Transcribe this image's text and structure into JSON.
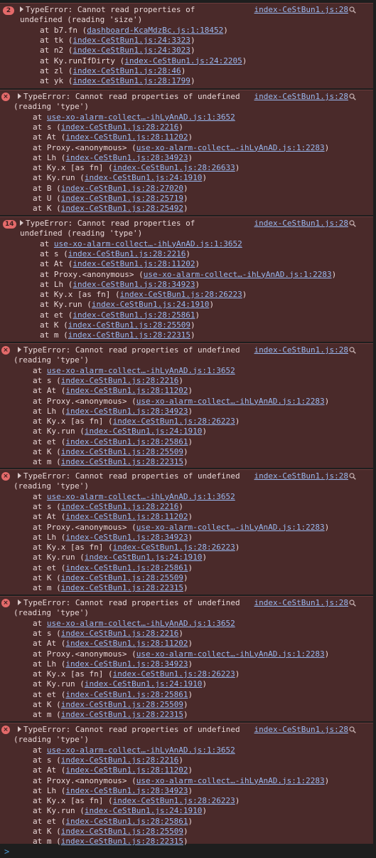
{
  "entries": [
    {
      "badge": "2",
      "badge_kind": "count",
      "message_lines": [
        "TypeError: Cannot read properties of",
        "undefined (reading 'size')"
      ],
      "source": "index-CeStBun1.js:28",
      "frames": [
        {
          "fn": "b7.fn",
          "file": "dashboard-KcaMdzBc.js:1:18452"
        },
        {
          "fn": "tk",
          "file": "index-CeStBun1.js:24:3323"
        },
        {
          "fn": "n2",
          "file": "index-CeStBun1.js:24:3023"
        },
        {
          "fn": "Ky.runIfDirty",
          "file": "index-CeStBun1.js:24:2205"
        },
        {
          "fn": "zl",
          "file": "index-CeStBun1.js:28:46"
        },
        {
          "fn": "yk",
          "file": "index-CeStBun1.js:28:1799"
        }
      ]
    },
    {
      "badge": "×",
      "badge_kind": "error",
      "message_lines": [
        "TypeError: Cannot read properties of undefined",
        "(reading 'type')"
      ],
      "source": "index-CeStBun1.js:28",
      "frames": [
        {
          "fn": "",
          "file": "use-xo-alarm-collect…-ihLyAnAD.js:1:3652"
        },
        {
          "fn": "s",
          "file": "index-CeStBun1.js:28:2216"
        },
        {
          "fn": "At",
          "file": "index-CeStBun1.js:28:11202"
        },
        {
          "fn": "Proxy.<anonymous>",
          "file": "use-xo-alarm-collect…-ihLyAnAD.js:1:2283"
        },
        {
          "fn": "Lh",
          "file": "index-CeStBun1.js:28:34923"
        },
        {
          "fn": "Ky.x [as fn]",
          "file": "index-CeStBun1.js:28:26633"
        },
        {
          "fn": "Ky.run",
          "file": "index-CeStBun1.js:24:1910"
        },
        {
          "fn": "B",
          "file": "index-CeStBun1.js:28:27020"
        },
        {
          "fn": "U",
          "file": "index-CeStBun1.js:28:25719"
        },
        {
          "fn": "K",
          "file": "index-CeStBun1.js:28:25492"
        }
      ]
    },
    {
      "badge": "14",
      "badge_kind": "count",
      "message_lines": [
        "TypeError: Cannot read properties of",
        "undefined (reading 'type')"
      ],
      "source": "index-CeStBun1.js:28",
      "frames": [
        {
          "fn": "",
          "file": "use-xo-alarm-collect…-ihLyAnAD.js:1:3652"
        },
        {
          "fn": "s",
          "file": "index-CeStBun1.js:28:2216"
        },
        {
          "fn": "At",
          "file": "index-CeStBun1.js:28:11202"
        },
        {
          "fn": "Proxy.<anonymous>",
          "file": "use-xo-alarm-collect…-ihLyAnAD.js:1:2283"
        },
        {
          "fn": "Lh",
          "file": "index-CeStBun1.js:28:34923"
        },
        {
          "fn": "Ky.x [as fn]",
          "file": "index-CeStBun1.js:28:26223"
        },
        {
          "fn": "Ky.run",
          "file": "index-CeStBun1.js:24:1910"
        },
        {
          "fn": "et",
          "file": "index-CeStBun1.js:28:25861"
        },
        {
          "fn": "K",
          "file": "index-CeStBun1.js:28:25509"
        },
        {
          "fn": "m",
          "file": "index-CeStBun1.js:28:22315"
        }
      ]
    },
    {
      "badge": "×",
      "badge_kind": "error",
      "message_lines": [
        "TypeError: Cannot read properties of undefined",
        "(reading 'type')"
      ],
      "source": "index-CeStBun1.js:28",
      "frames": [
        {
          "fn": "",
          "file": "use-xo-alarm-collect…-ihLyAnAD.js:1:3652"
        },
        {
          "fn": "s",
          "file": "index-CeStBun1.js:28:2216"
        },
        {
          "fn": "At",
          "file": "index-CeStBun1.js:28:11202"
        },
        {
          "fn": "Proxy.<anonymous>",
          "file": "use-xo-alarm-collect…-ihLyAnAD.js:1:2283"
        },
        {
          "fn": "Lh",
          "file": "index-CeStBun1.js:28:34923"
        },
        {
          "fn": "Ky.x [as fn]",
          "file": "index-CeStBun1.js:28:26223"
        },
        {
          "fn": "Ky.run",
          "file": "index-CeStBun1.js:24:1910"
        },
        {
          "fn": "et",
          "file": "index-CeStBun1.js:28:25861"
        },
        {
          "fn": "K",
          "file": "index-CeStBun1.js:28:25509"
        },
        {
          "fn": "m",
          "file": "index-CeStBun1.js:28:22315"
        }
      ]
    },
    {
      "badge": "×",
      "badge_kind": "error",
      "message_lines": [
        "TypeError: Cannot read properties of undefined",
        "(reading 'type')"
      ],
      "source": "index-CeStBun1.js:28",
      "frames": [
        {
          "fn": "",
          "file": "use-xo-alarm-collect…-ihLyAnAD.js:1:3652"
        },
        {
          "fn": "s",
          "file": "index-CeStBun1.js:28:2216"
        },
        {
          "fn": "At",
          "file": "index-CeStBun1.js:28:11202"
        },
        {
          "fn": "Proxy.<anonymous>",
          "file": "use-xo-alarm-collect…-ihLyAnAD.js:1:2283"
        },
        {
          "fn": "Lh",
          "file": "index-CeStBun1.js:28:34923"
        },
        {
          "fn": "Ky.x [as fn]",
          "file": "index-CeStBun1.js:28:26223"
        },
        {
          "fn": "Ky.run",
          "file": "index-CeStBun1.js:24:1910"
        },
        {
          "fn": "et",
          "file": "index-CeStBun1.js:28:25861"
        },
        {
          "fn": "K",
          "file": "index-CeStBun1.js:28:25509"
        },
        {
          "fn": "m",
          "file": "index-CeStBun1.js:28:22315"
        }
      ]
    },
    {
      "badge": "×",
      "badge_kind": "error",
      "message_lines": [
        "TypeError: Cannot read properties of undefined",
        "(reading 'type')"
      ],
      "source": "index-CeStBun1.js:28",
      "frames": [
        {
          "fn": "",
          "file": "use-xo-alarm-collect…-ihLyAnAD.js:1:3652"
        },
        {
          "fn": "s",
          "file": "index-CeStBun1.js:28:2216"
        },
        {
          "fn": "At",
          "file": "index-CeStBun1.js:28:11202"
        },
        {
          "fn": "Proxy.<anonymous>",
          "file": "use-xo-alarm-collect…-ihLyAnAD.js:1:2283"
        },
        {
          "fn": "Lh",
          "file": "index-CeStBun1.js:28:34923"
        },
        {
          "fn": "Ky.x [as fn]",
          "file": "index-CeStBun1.js:28:26223"
        },
        {
          "fn": "Ky.run",
          "file": "index-CeStBun1.js:24:1910"
        },
        {
          "fn": "et",
          "file": "index-CeStBun1.js:28:25861"
        },
        {
          "fn": "K",
          "file": "index-CeStBun1.js:28:25509"
        },
        {
          "fn": "m",
          "file": "index-CeStBun1.js:28:22315"
        }
      ]
    },
    {
      "badge": "×",
      "badge_kind": "error",
      "message_lines": [
        "TypeError: Cannot read properties of undefined",
        "(reading 'type')"
      ],
      "source": "index-CeStBun1.js:28",
      "frames": [
        {
          "fn": "",
          "file": "use-xo-alarm-collect…-ihLyAnAD.js:1:3652"
        },
        {
          "fn": "s",
          "file": "index-CeStBun1.js:28:2216"
        },
        {
          "fn": "At",
          "file": "index-CeStBun1.js:28:11202"
        },
        {
          "fn": "Proxy.<anonymous>",
          "file": "use-xo-alarm-collect…-ihLyAnAD.js:1:2283"
        },
        {
          "fn": "Lh",
          "file": "index-CeStBun1.js:28:34923"
        },
        {
          "fn": "Ky.x [as fn]",
          "file": "index-CeStBun1.js:28:26223"
        },
        {
          "fn": "Ky.run",
          "file": "index-CeStBun1.js:24:1910"
        },
        {
          "fn": "et",
          "file": "index-CeStBun1.js:28:25861"
        },
        {
          "fn": "K",
          "file": "index-CeStBun1.js:28:25509"
        },
        {
          "fn": "m",
          "file": "index-CeStBun1.js:28:22315"
        }
      ]
    }
  ],
  "prompt": ">",
  "colors": {
    "entry_bg": "#4a2a2a",
    "link": "#9ab8f0",
    "badge": "#e46a6a",
    "prompt": "#4d9bd5"
  }
}
